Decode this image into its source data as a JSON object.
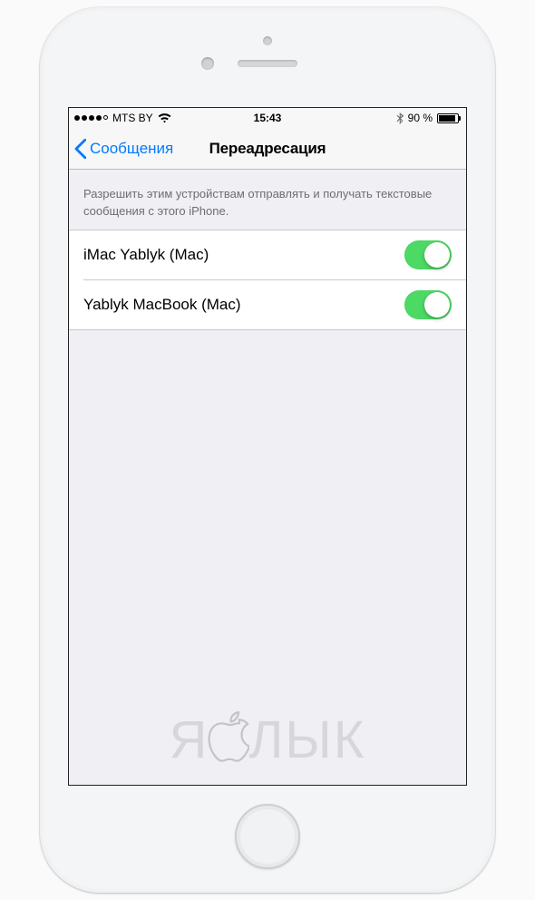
{
  "status": {
    "carrier": "MTS BY",
    "time": "15:43",
    "battery_text": "90 %",
    "battery_percent": 90
  },
  "nav": {
    "back_label": "Сообщения",
    "title": "Переадресация"
  },
  "section": {
    "description": "Разрешить этим устройствам отправлять и получать текстовые сообщения с этого iPhone."
  },
  "devices": [
    {
      "name": "iMac Yablyk (Mac)",
      "enabled": true
    },
    {
      "name": "Yablyk MacBook (Mac)",
      "enabled": true
    }
  ],
  "watermark": {
    "pre": "Я",
    "post": "ЛЫК"
  },
  "colors": {
    "tint": "#007aff",
    "switch_on": "#4cd964"
  }
}
